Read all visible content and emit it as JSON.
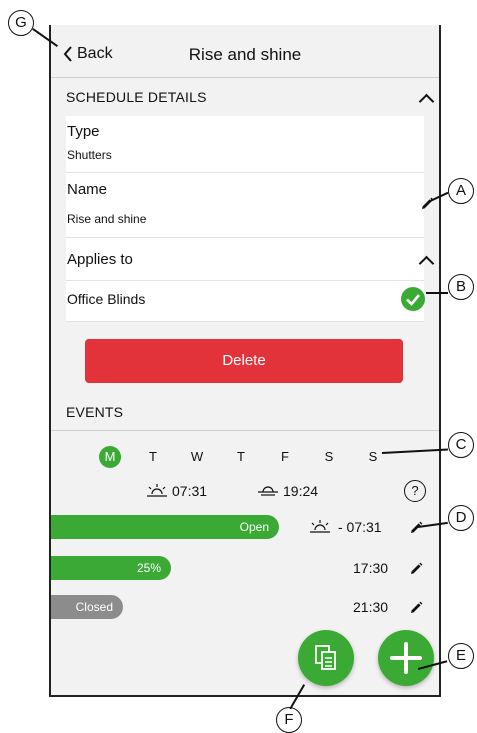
{
  "header": {
    "back_label": "Back",
    "title": "Rise and shine"
  },
  "schedule_details": {
    "section_label": "SCHEDULE DETAILS",
    "type_label": "Type",
    "type_value": "Shutters",
    "name_label": "Name",
    "name_value": "Rise and shine",
    "applies_to_label": "Applies to",
    "device_name": "Office Blinds"
  },
  "delete_label": "Delete",
  "events": {
    "section_label": "EVENTS",
    "days": [
      "M",
      "T",
      "W",
      "T",
      "F",
      "S",
      "S"
    ],
    "selected_day": "M",
    "sunrise_time": "07:31",
    "sunset_time": "19:24",
    "help_label": "?",
    "items": [
      {
        "position_label": "Open",
        "level": 1.0,
        "time": "- 07:31",
        "sunrise_relative": true
      },
      {
        "position_label": "25%",
        "level": 0.25,
        "time": "17:30",
        "sunrise_relative": false
      },
      {
        "position_label": "Closed",
        "level": 0.0,
        "time": "21:30",
        "sunrise_relative": false
      }
    ]
  },
  "callouts": {
    "a": "A",
    "b": "B",
    "c": "C",
    "d": "D",
    "e": "E",
    "f": "F",
    "g": "G"
  },
  "colors": {
    "accent_green": "#3aaa35",
    "delete_red": "#e2323a",
    "closed_grey": "#8c8c8c"
  },
  "icons": [
    "back-chevron-icon",
    "chevron-up-icon",
    "pencil-icon",
    "checkmark-icon",
    "sunrise-icon",
    "sunset-icon",
    "help-icon",
    "copy-icon",
    "plus-icon"
  ]
}
